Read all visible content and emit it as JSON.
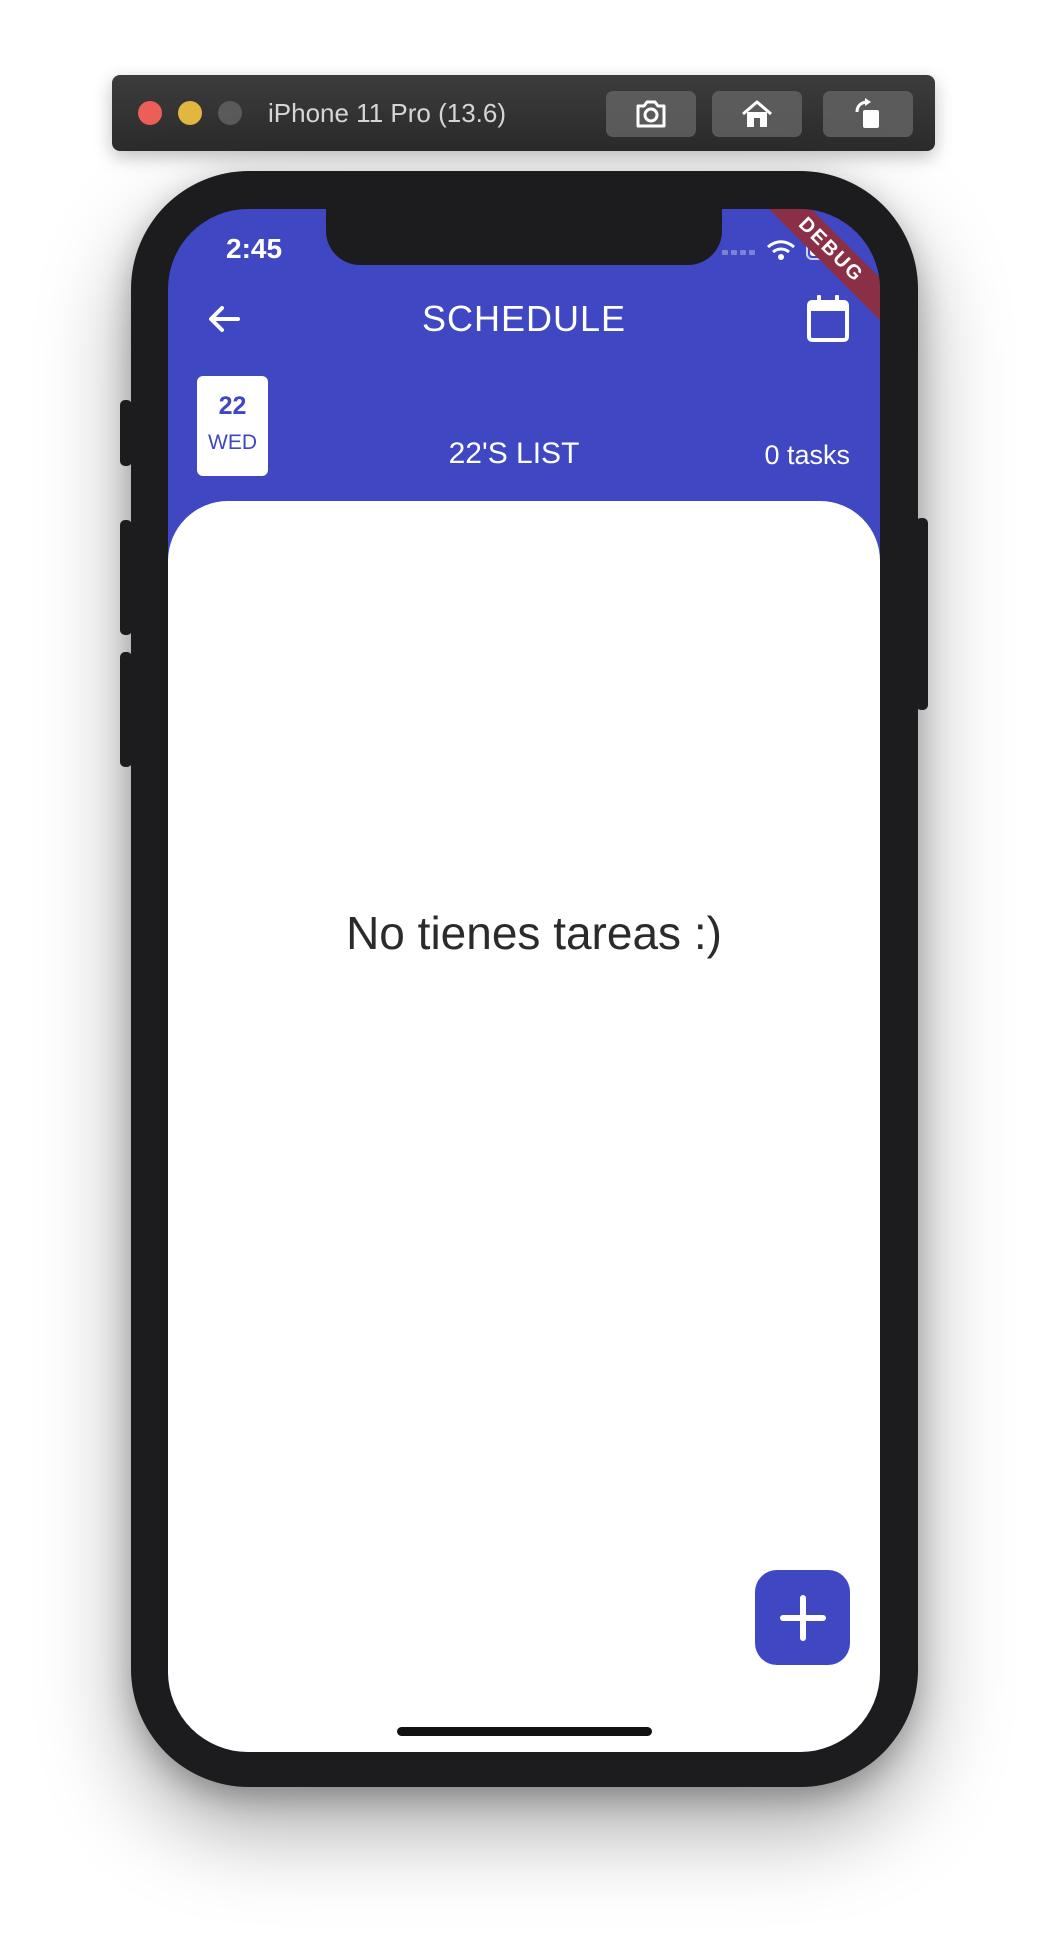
{
  "simulator": {
    "title": "iPhone 11 Pro (13.6)",
    "buttons": [
      {
        "icon": "screenshot-icon"
      },
      {
        "icon": "home-icon"
      },
      {
        "icon": "rotate-icon"
      }
    ]
  },
  "status_bar": {
    "time": "2:45"
  },
  "debug_banner": "DEBUG",
  "app_bar": {
    "title": "SCHEDULE",
    "back_icon": "arrow-back-icon",
    "calendar_icon": "calendar-icon"
  },
  "day": {
    "number": "22",
    "weekday": "WED",
    "list_title": "22'S LIST",
    "task_count": "0 tasks"
  },
  "empty_state": "No tienes tareas :)",
  "fab": {
    "icon": "add-icon"
  },
  "colors": {
    "primary": "#3f47c3",
    "debug_ribbon": "#8b2f46"
  }
}
